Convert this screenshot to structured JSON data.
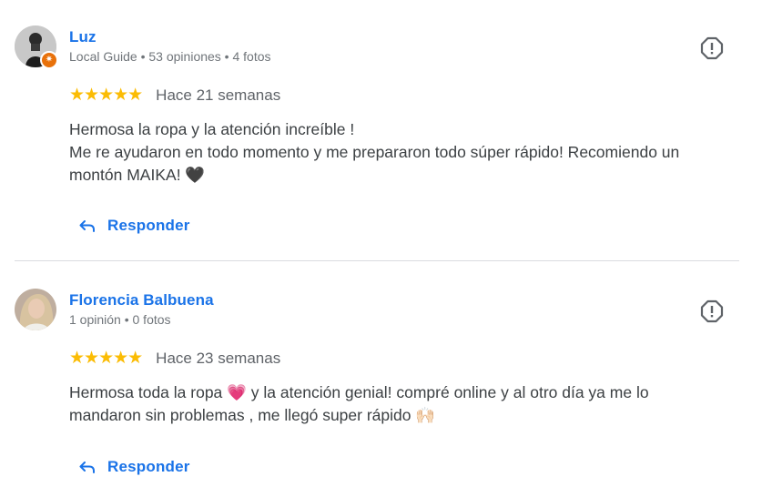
{
  "reviews": [
    {
      "name": "Luz",
      "meta": "Local Guide • 53 opiniones • 4 fotos",
      "stars": "★★★★★",
      "date": "Hace 21 semanas",
      "text_line1": "Hermosa la ropa y la atención increíble !",
      "text_line2": "Me re ayudaron en todo momento y me prepararon todo súper rápido! Recomiendo un",
      "text_line3": "montón MAIKA! 🖤",
      "reply_label": "Responder",
      "avatar_icon": "user-photo",
      "badge_icon": "local-guide-star-icon"
    },
    {
      "name": "Florencia Balbuena",
      "meta": "1 opinión • 0 fotos",
      "stars": "★★★★★",
      "date": "Hace 23 semanas",
      "text_line1": "Hermosa toda la ropa 💗  y la atención genial! compré online y al otro día ya me lo",
      "text_line2": "mandaron sin problemas , me llegó super rápido 🙌🏻",
      "reply_label": "Responder",
      "avatar_icon": "user-photo"
    }
  ],
  "colors": {
    "name": "#1a73e8",
    "star": "#fbbc04",
    "badge": "#e8710a",
    "meta": "#70757a"
  }
}
